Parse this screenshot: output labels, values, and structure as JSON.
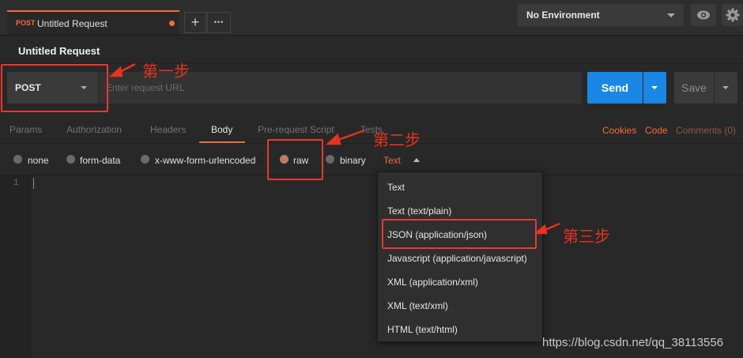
{
  "tab": {
    "method": "POST",
    "title": "Untitled Request"
  },
  "tab_controls": {
    "add": "+",
    "more": "•••"
  },
  "environment": {
    "selected": "No Environment"
  },
  "request": {
    "title": "Untitled Request",
    "method": "POST",
    "url_placeholder": "Enter request URL",
    "send_label": "Send",
    "save_label": "Save"
  },
  "subtabs": [
    "Params",
    "Authorization",
    "Headers",
    "Body",
    "Pre-request Script",
    "Tests"
  ],
  "right_links": {
    "cookies": "Cookies",
    "code": "Code",
    "comments": "Comments (0)"
  },
  "body_types": [
    "none",
    "form-data",
    "x-www-form-urlencoded",
    "raw",
    "binary"
  ],
  "selected_body_type": "raw",
  "raw_type": "Text",
  "editor": {
    "line_number": "1"
  },
  "dropdown_options": [
    "Text",
    "Text (text/plain)",
    "JSON (application/json)",
    "Javascript (application/javascript)",
    "XML (application/xml)",
    "XML (text/xml)",
    "HTML (text/html)"
  ],
  "annotations": {
    "step1": "第一步",
    "step2": "第二步",
    "step3": "第三步"
  },
  "watermark": "https://blog.csdn.net/qq_38113556",
  "colors": {
    "accent": "#f26b3a",
    "send": "#1a87e4",
    "annotation": "#e8321f"
  }
}
